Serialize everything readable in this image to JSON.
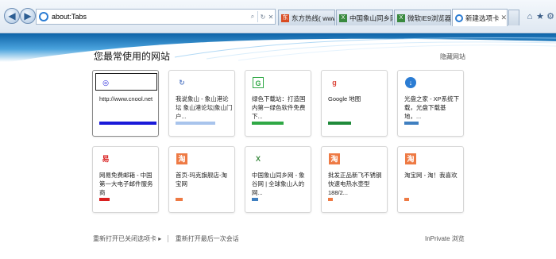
{
  "address": {
    "url": "about:Tabs"
  },
  "tabs": [
    {
      "label": "东方热线( www.c...",
      "icon_color": "#d94b21"
    },
    {
      "label": "中国象山同乡网 ...",
      "icon_color": "#3a8a3f"
    },
    {
      "label": "微软IE9浏览器抢...",
      "icon_color": "#3a8a3f"
    },
    {
      "label": "新建选项卡",
      "icon_color": "#2b7cd3"
    }
  ],
  "page": {
    "heading": "您最常使用的网站",
    "hide_link": "隐藏网站"
  },
  "tiles": [
    {
      "title": "http://www.cnool.net",
      "bar_color": "#1a1ad9",
      "bar_fill": 1.0,
      "icon": "cnool-icon"
    },
    {
      "title": "我说象山 - 象山港论坛 象山港论坛|象山门户...",
      "bar_color": "#a8c4ec",
      "bar_fill": 0.7,
      "icon": "refresh-logo-icon"
    },
    {
      "title": "绿色下载站：打造国内第一绿色软件免费下...",
      "bar_color": "#2fa845",
      "bar_fill": 0.55,
      "icon": "green-g-icon"
    },
    {
      "title": "Google 地图",
      "bar_color": "#1f8a3a",
      "bar_fill": 0.4,
      "icon": "google-maps-icon"
    },
    {
      "title": "光盘之家 - XP系统下载，光盘下载基地，...",
      "bar_color": "#3f7fc0",
      "bar_fill": 0.25,
      "icon": "download-arrow-icon"
    },
    {
      "title": "网易免费邮箱 - 中国第一大电子邮件服务商",
      "bar_color": "#d92020",
      "bar_fill": 0.18,
      "icon": "netease-icon"
    },
    {
      "title": "首页-玛克旗舰店-淘宝网",
      "bar_color": "#ee7a44",
      "bar_fill": 0.13,
      "icon": "taobao-icon"
    },
    {
      "title": "中国象山同乡网 - 象谷网 | 全球象山人的网...",
      "bar_color": "#3f7fc0",
      "bar_fill": 0.11,
      "icon": "xiangshan-icon"
    },
    {
      "title": "批发正品新飞不锈钢快速电热水壶型188/2...",
      "bar_color": "#ee7a44",
      "bar_fill": 0.09,
      "icon": "taobao-icon"
    },
    {
      "title": "淘宝网 - 淘！我喜欢",
      "bar_color": "#ee7a44",
      "bar_fill": 0.08,
      "icon": "taobao-icon"
    }
  ],
  "footer": {
    "reopen_closed": "重新打开已关闭选项卡",
    "reopen_session": "重新打开最后一次会话",
    "inprivate": "InPrivate 浏览"
  }
}
